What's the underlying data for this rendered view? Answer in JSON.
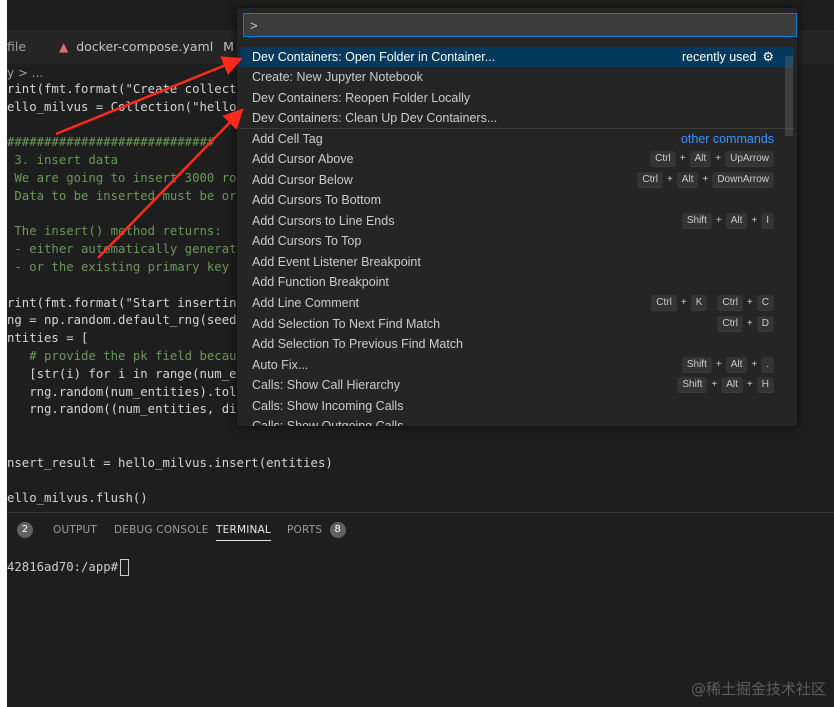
{
  "tabs": {
    "file": "file",
    "docker_compose": "docker-compose.yaml",
    "docker_modified": "M"
  },
  "breadcrumb": "y > ...",
  "code_lines": [
    "rint(fmt.format(\"Create collect",
    "ello_milvus = Collection(\"hello",
    "",
    "############################",
    " 3. insert data",
    " We are going to insert 3000 ro",
    " Data to be inserted must be or",
    "",
    " The insert() method returns:",
    " - either automatically generat",
    " - or the existing primary key",
    "",
    "rint(fmt.format(\"Start insertin",
    "ng = np.random.default_rng(seed",
    "ntities = [",
    "   # provide the pk field becau",
    "   [str(i) for i in range(num_e",
    "   rng.random(num_entities).tol",
    "   rng.random((num_entities, di",
    "",
    "",
    "nsert_result = hello_milvus.insert(entities)",
    "",
    "ello_milvus.flush()"
  ],
  "panel": {
    "problems_count": "2",
    "output": "OUTPUT",
    "debug_console": "DEBUG CONSOLE",
    "terminal": "TERMINAL",
    "ports": "PORTS",
    "ports_count": "8",
    "terminal_prompt": "42816ad70:/app#"
  },
  "palette": {
    "input_value": ">",
    "recently_used": "recently used",
    "other_commands": "other commands",
    "plus": "+",
    "items": [
      {
        "label": "Dev Containers: Open Folder in Container..."
      },
      {
        "label": "Create: New Jupyter Notebook"
      },
      {
        "label": "Dev Containers: Reopen Folder Locally"
      },
      {
        "label": "Dev Containers: Clean Up Dev Containers..."
      },
      {
        "label": "Add Cell Tag"
      },
      {
        "label": "Add Cursor Above",
        "keys": [
          "Ctrl",
          "Alt",
          "UpArrow"
        ]
      },
      {
        "label": "Add Cursor Below",
        "keys": [
          "Ctrl",
          "Alt",
          "DownArrow"
        ]
      },
      {
        "label": "Add Cursors To Bottom"
      },
      {
        "label": "Add Cursors to Line Ends",
        "keys": [
          "Shift",
          "Alt",
          "I"
        ]
      },
      {
        "label": "Add Cursors To Top"
      },
      {
        "label": "Add Event Listener Breakpoint"
      },
      {
        "label": "Add Function Breakpoint"
      },
      {
        "label": "Add Line Comment",
        "keys": [
          "Ctrl",
          "K"
        ],
        "keys2": [
          "Ctrl",
          "C"
        ]
      },
      {
        "label": "Add Selection To Next Find Match",
        "keys": [
          "Ctrl",
          "D"
        ]
      },
      {
        "label": "Add Selection To Previous Find Match"
      },
      {
        "label": "Auto Fix...",
        "keys": [
          "Shift",
          "Alt",
          "."
        ]
      },
      {
        "label": "Calls: Show Call Hierarchy",
        "keys": [
          "Shift",
          "Alt",
          "H"
        ]
      },
      {
        "label": "Calls: Show Incoming Calls"
      },
      {
        "label": "Calls: Show Outgoing Calls"
      }
    ]
  },
  "watermark": "@稀土掘金技术社区",
  "colors": {
    "accent": "#007fd4",
    "selection": "#04395e",
    "arrow": "#ff2a1a"
  }
}
